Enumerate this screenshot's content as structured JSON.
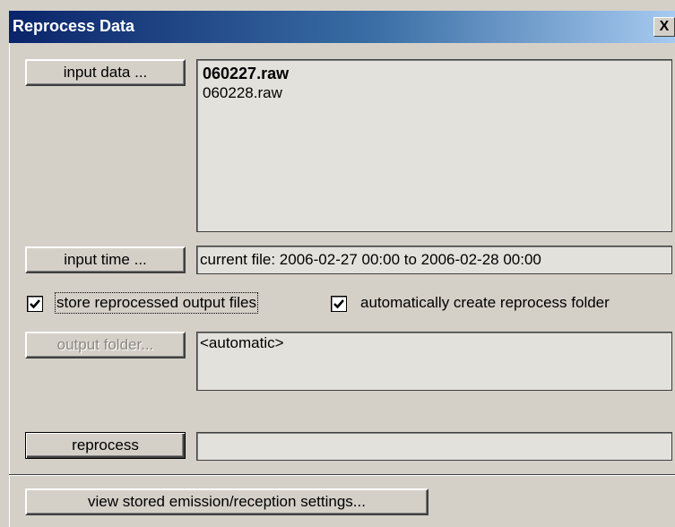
{
  "window": {
    "title": "Reprocess Data",
    "close_label": "X"
  },
  "input_data": {
    "button_label": "input data ...",
    "files": [
      {
        "name": "060227.raw",
        "selected": true
      },
      {
        "name": "060228.raw",
        "selected": false
      }
    ]
  },
  "input_time": {
    "button_label": "input time ...",
    "value": "current file: 2006-02-27 00:00 to 2006-02-28 00:00"
  },
  "options": {
    "store_output": {
      "label": "store reprocessed output files",
      "checked": true
    },
    "auto_folder": {
      "label": "automatically create reprocess folder",
      "checked": true
    }
  },
  "output_folder": {
    "button_label": "output folder...",
    "value": "<automatic>"
  },
  "reprocess": {
    "button_label": "reprocess",
    "progress": ""
  },
  "view_settings": {
    "button_label": "view stored emission/reception settings..."
  }
}
